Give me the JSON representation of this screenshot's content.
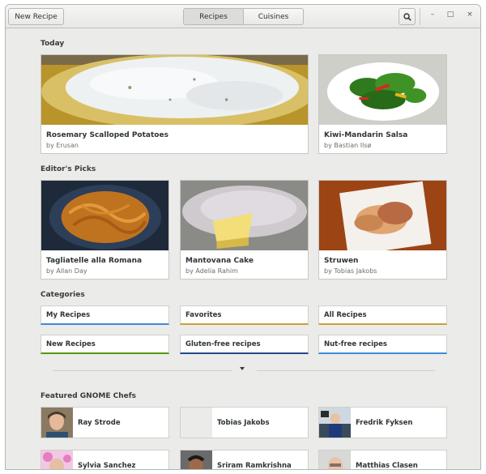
{
  "header": {
    "new_recipe_label": "New Recipe",
    "tabs": [
      "Recipes",
      "Cuisines"
    ],
    "search_icon": "search-icon",
    "window_controls": [
      "–",
      "□",
      "×"
    ]
  },
  "sections": {
    "today": "Today",
    "editors_picks": "Editor's Picks",
    "categories": "Categories",
    "featured_chefs": "Featured GNOME Chefs"
  },
  "today": [
    {
      "title": "Rosemary Scalloped Potatoes",
      "author": "by Erusan"
    },
    {
      "title": "Kiwi-Mandarin Salsa",
      "author": "by Bastian Ilsø"
    }
  ],
  "editors_picks": [
    {
      "title": "Tagliatelle alla Romana",
      "author": "by Allan Day"
    },
    {
      "title": "Mantovana Cake",
      "author": "by Adelia Rahim"
    },
    {
      "title": "Struwen",
      "author": "by Tobias Jakobs"
    }
  ],
  "categories": [
    {
      "label": "My Recipes",
      "color": "#3d8bd8"
    },
    {
      "label": "Favorites",
      "color": "#c9a13a"
    },
    {
      "label": "All Recipes",
      "color": "#c9a13a"
    },
    {
      "label": "New Recipes",
      "color": "#4e9a06"
    },
    {
      "label": "Gluten-free recipes",
      "color": "#204a87"
    },
    {
      "label": "Nut-free recipes",
      "color": "#3d8bd8"
    }
  ],
  "chefs": [
    {
      "name": "Ray Strode"
    },
    {
      "name": "Tobias Jakobs"
    },
    {
      "name": "Fredrik Fyksen"
    },
    {
      "name": "Sylvia Sanchez"
    },
    {
      "name": "Sriram Ramkrishna"
    },
    {
      "name": "Matthias Clasen"
    }
  ]
}
